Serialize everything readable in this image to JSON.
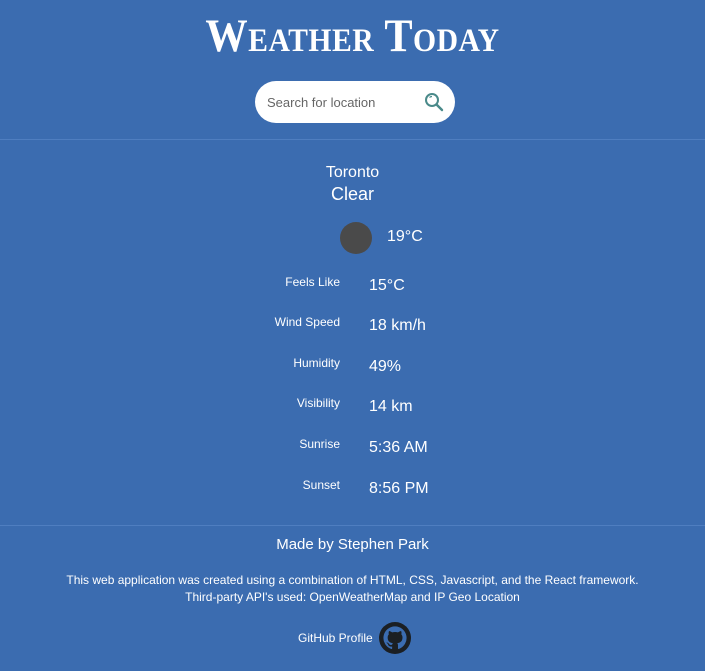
{
  "header": {
    "title": "Weather Today",
    "search": {
      "placeholder": "Search for location",
      "value": ""
    }
  },
  "weather": {
    "city": "Toronto",
    "condition": "Clear",
    "temperature": "19°C",
    "details": [
      {
        "label": "Feels Like",
        "value": "15°C"
      },
      {
        "label": "Wind Speed",
        "value": "18 km/h"
      },
      {
        "label": "Humidity",
        "value": "49%"
      },
      {
        "label": "Visibility",
        "value": "14 km"
      },
      {
        "label": "Sunrise",
        "value": "5:36 AM"
      },
      {
        "label": "Sunset",
        "value": "8:56 PM"
      }
    ]
  },
  "footer": {
    "made_by": "Made by Stephen Park",
    "description_line1": "This web application was created using a combination of HTML, CSS, Javascript, and the React framework.",
    "description_line2": "Third-party API's used: OpenWeatherMap and IP Geo Location",
    "github_label": "GitHub Profile"
  },
  "colors": {
    "background": "#3b6cb0",
    "text": "#ffffff",
    "search_bg": "#ffffff",
    "weather_icon": "#4a4a4a",
    "github_icon": "#1b1f23"
  },
  "icons": {
    "search": "search-icon",
    "weather": "clear-weather-icon",
    "github": "github-icon"
  }
}
